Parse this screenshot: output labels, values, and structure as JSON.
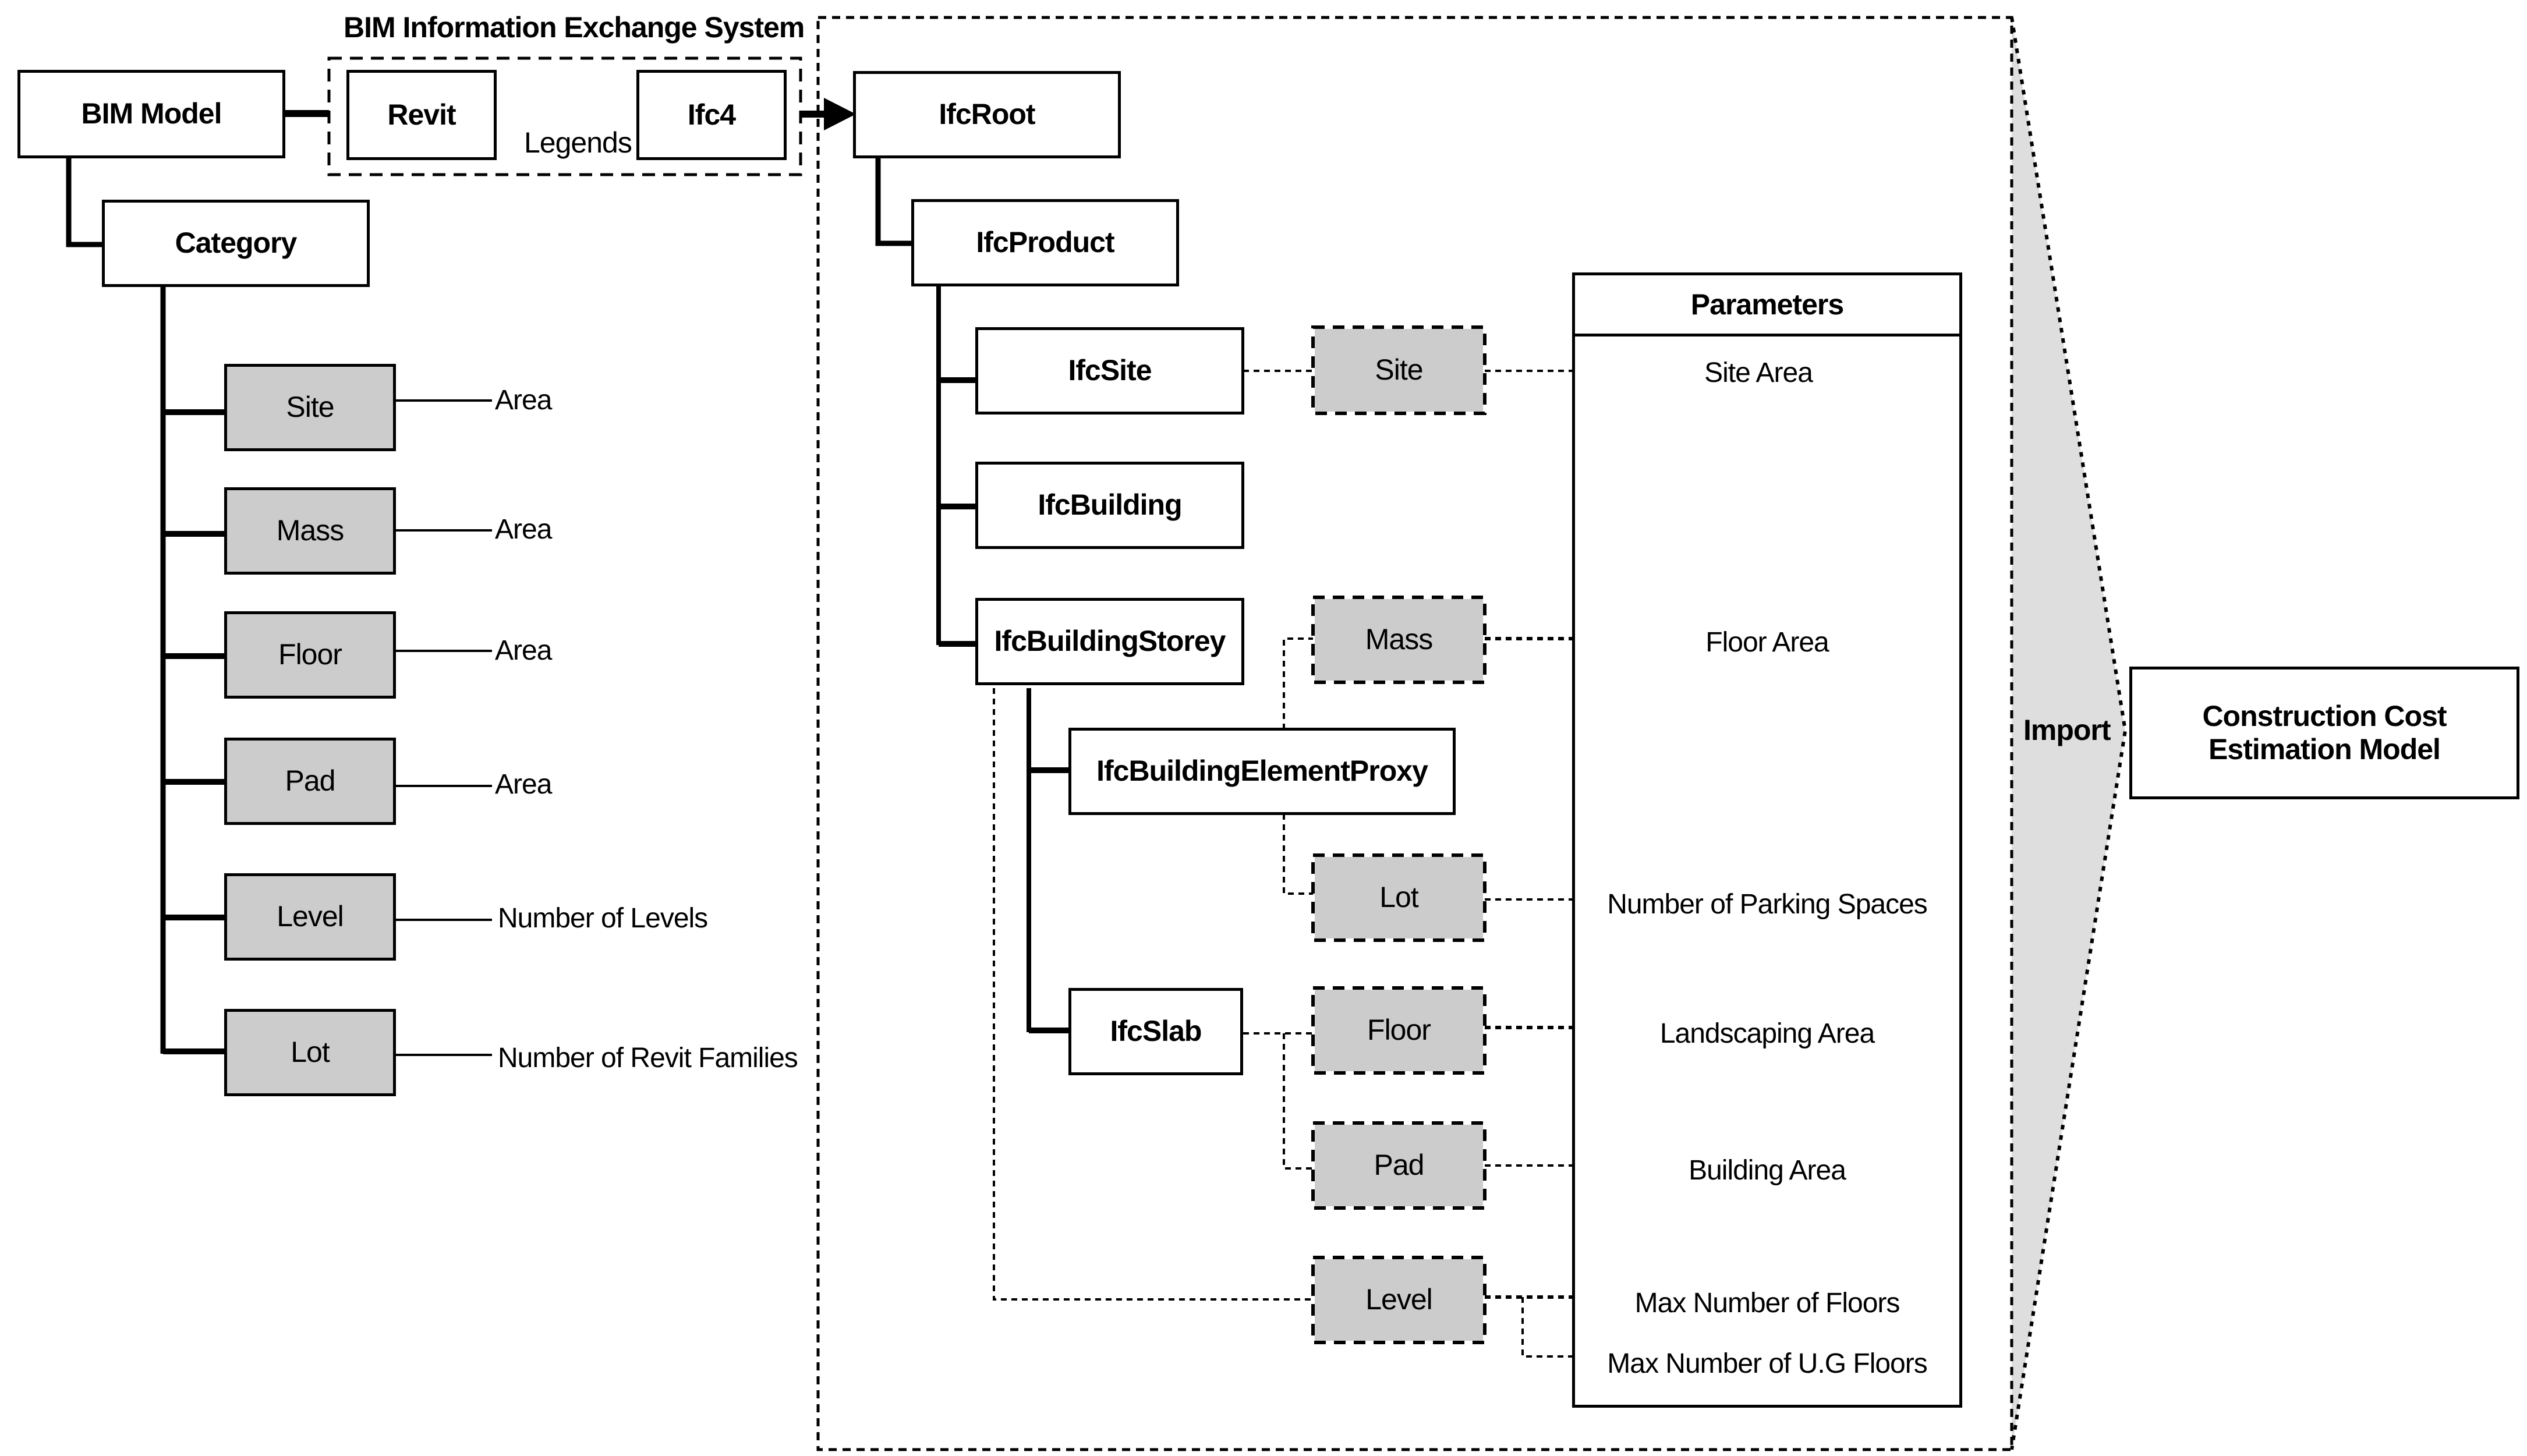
{
  "title": "BIM Information Exchange System",
  "legend": {
    "label": "Legends",
    "revit_label": "Revit",
    "ifc_label": "Ifc4"
  },
  "revit_tree": {
    "root": "BIM Model",
    "category": "Category",
    "items": [
      {
        "name": "Site",
        "attribute": "Area"
      },
      {
        "name": "Mass",
        "attribute": "Area"
      },
      {
        "name": "Floor",
        "attribute": "Area"
      },
      {
        "name": "Pad",
        "attribute": "Area"
      },
      {
        "name": "Level",
        "attribute": "Number of Levels"
      },
      {
        "name": "Lot",
        "attribute": "Number of Revit Families"
      }
    ]
  },
  "ifc_tree": {
    "root": "IfcRoot",
    "product": "IfcProduct",
    "site": "IfcSite",
    "building": "IfcBuilding",
    "storey": "IfcBuildingStorey",
    "proxy": "IfcBuildingElementProxy",
    "slab": "IfcSlab"
  },
  "mapped_elements": {
    "site": "Site",
    "mass": "Mass",
    "lot": "Lot",
    "floor": "Floor",
    "pad": "Pad",
    "level": "Level"
  },
  "parameters": {
    "header": "Parameters",
    "items": [
      "Site Area",
      "Floor Area",
      "Number of Parking Spaces",
      "Landscaping Area",
      "Building Area",
      "Max Number of Floors",
      "Max Number of U.G Floors"
    ]
  },
  "import_label": "Import",
  "target_model": {
    "line1": "Construction Cost",
    "line2": "Estimation Model"
  },
  "colors": {
    "revit_fill": "#cbcccb",
    "import_fill": "#dddedd",
    "stroke": "#000000",
    "background": "#ffffff"
  }
}
